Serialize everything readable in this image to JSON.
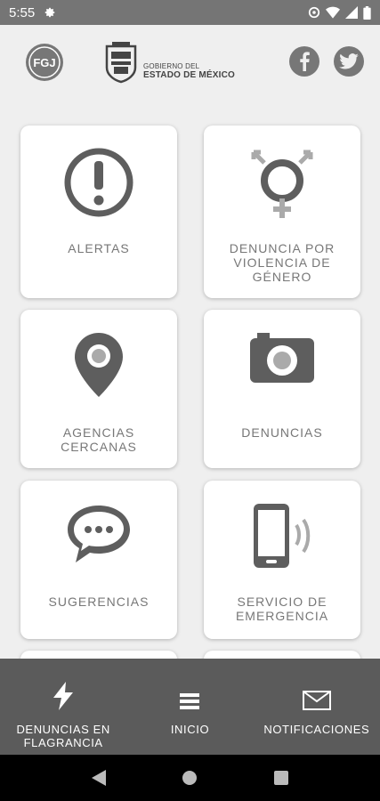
{
  "status_bar": {
    "time": "5:55"
  },
  "header": {
    "fgj_logo_text": "FGJ",
    "gov_line1": "GOBIERNO DEL",
    "gov_line2": "ESTADO DE MÉXICO"
  },
  "cards": [
    {
      "label": "ALERTAS",
      "icon": "alert-icon"
    },
    {
      "label": "DENUNCIA POR VIOLENCIA DE GÉNERO",
      "icon": "gender-icon"
    },
    {
      "label": "AGENCIAS CERCANAS",
      "icon": "location-pin-icon"
    },
    {
      "label": "DENUNCIAS",
      "icon": "camera-icon"
    },
    {
      "label": "SUGERENCIAS",
      "icon": "chat-bubble-icon"
    },
    {
      "label": "SERVICIO DE EMERGENCIA",
      "icon": "phone-vibrate-icon"
    }
  ],
  "bottom_nav": [
    {
      "label": "DENUNCIAS EN FLAGRANCIA",
      "icon": "lightning-icon"
    },
    {
      "label": "INICIO",
      "icon": "menu-icon"
    },
    {
      "label": "NOTIFICACIONES",
      "icon": "envelope-icon"
    }
  ],
  "colors": {
    "icon_gray": "#5e5e5e",
    "label_gray": "#777777",
    "nav_bg": "#5b5b5b",
    "status_bg": "#757575"
  }
}
